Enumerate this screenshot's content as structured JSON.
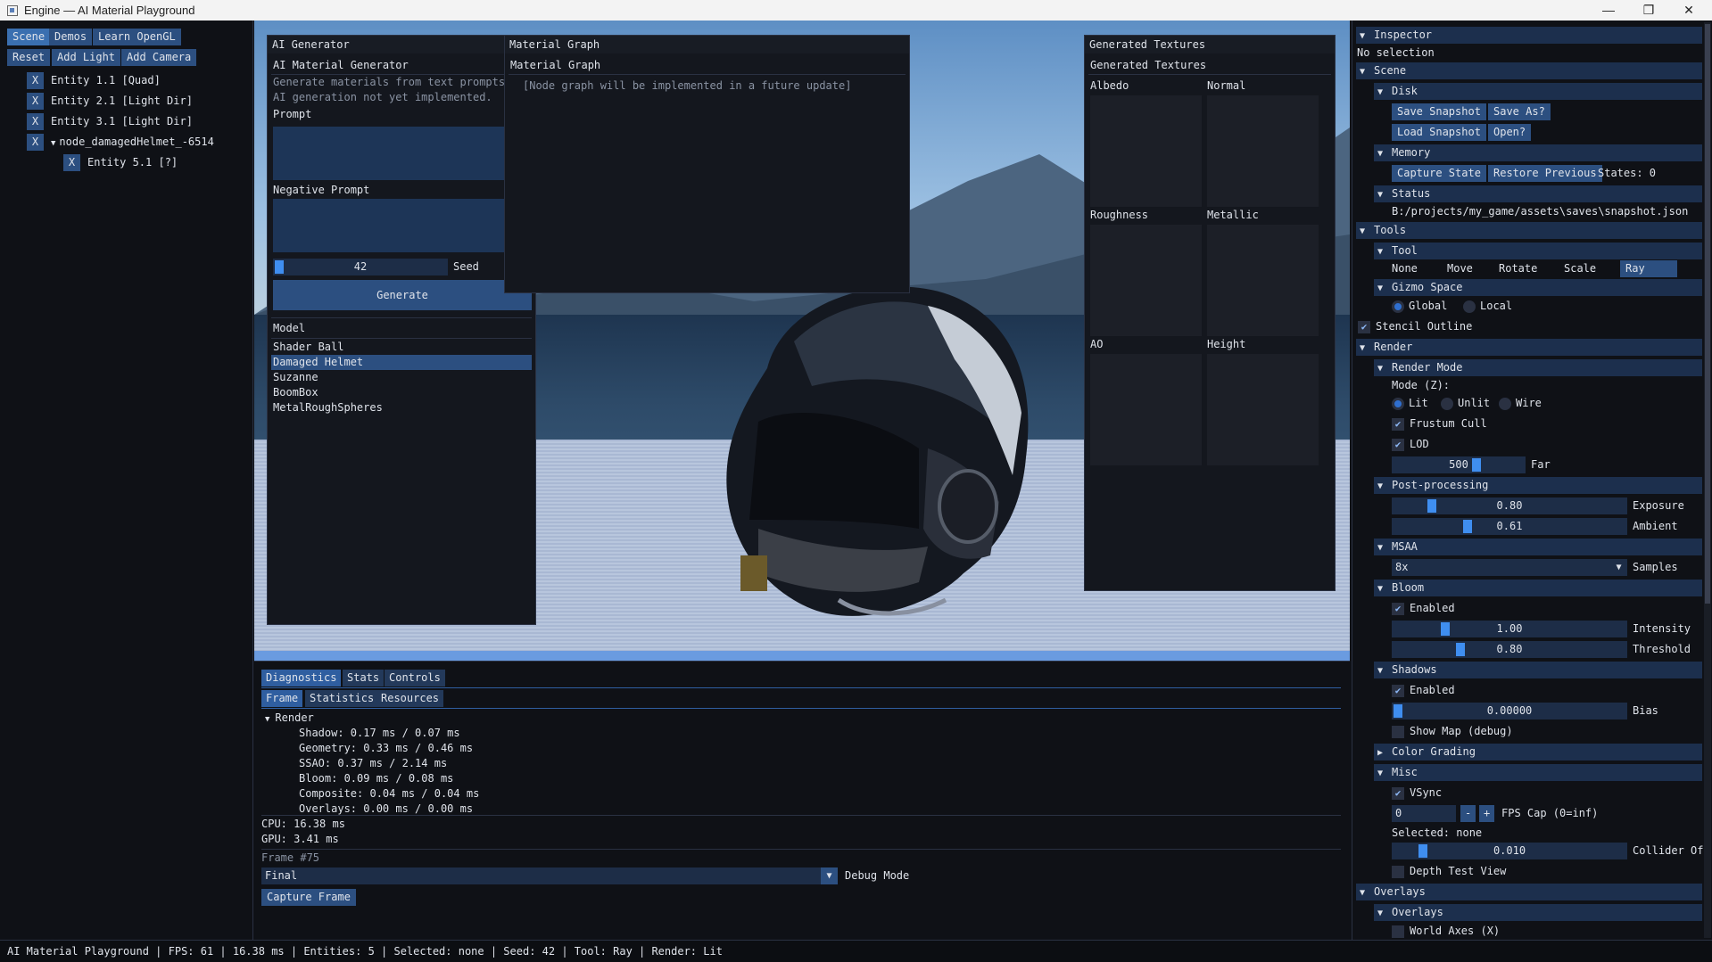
{
  "window": {
    "title": "Engine — AI Material Playground",
    "minimize": "—",
    "maximize": "❐",
    "close": "✕"
  },
  "toolbar": {
    "tabs": [
      "Scene",
      "Demos",
      "Learn OpenGL"
    ],
    "reset": "Reset",
    "add_light": "Add Light",
    "add_camera": "Add Camera"
  },
  "hierarchy": [
    {
      "x": "X",
      "label": "Entity 1.1  [Quad]"
    },
    {
      "x": "X",
      "label": "Entity 2.1  [Light Dir]"
    },
    {
      "x": "X",
      "label": "Entity 3.1  [Light Dir]"
    },
    {
      "x": "X",
      "label": "node_damagedHelmet_-6514",
      "expanded": true
    },
    {
      "x": "X",
      "label": "Entity 5.1  [?]"
    }
  ],
  "ai": {
    "window_title": "AI Generator",
    "header": "AI Material Generator",
    "desc1": "Generate materials from text prompts.",
    "desc2": "AI generation not yet implemented.",
    "prompt_label": "Prompt",
    "negative_label": "Negative Prompt",
    "seed_value": "42",
    "seed_label": "Seed",
    "generate": "Generate",
    "model_label": "Model",
    "models": [
      "Shader Ball",
      "Damaged Helmet",
      "Suzanne",
      "BoomBox",
      "MetalRoughSpheres"
    ],
    "selected_model": "Damaged Helmet"
  },
  "graph": {
    "window_title": "Material Graph",
    "header": "Material Graph",
    "note": "[Node graph will be implemented in a future update]"
  },
  "textures": {
    "window_title": "Generated Textures",
    "header": "Generated Textures",
    "slots": [
      "Albedo",
      "Normal",
      "Roughness",
      "Metallic",
      "AO",
      "Height"
    ]
  },
  "diag": {
    "tabs": [
      "Diagnostics",
      "Stats",
      "Controls"
    ],
    "subtabs": [
      "Frame",
      "Statistics",
      "Resources"
    ],
    "render_label": "Render",
    "lines": [
      "Shadow: 0.17 ms / 0.07 ms",
      "Geometry: 0.33 ms / 0.46 ms",
      "SSAO: 0.37 ms / 2.14 ms",
      "Bloom: 0.09 ms / 0.08 ms",
      "Composite: 0.04 ms / 0.04 ms",
      "Overlays: 0.00 ms / 0.00 ms"
    ],
    "cpu": "CPU: 16.38 ms",
    "gpu": "GPU: 3.41 ms",
    "frame": "Frame #75",
    "debug_value": "Final",
    "debug_label": "Debug Mode",
    "capture": "Capture Frame"
  },
  "inspector": {
    "title": "Inspector",
    "no_selection": "No selection",
    "scene": "Scene",
    "disk": "Disk",
    "save_snapshot": "Save Snapshot",
    "save_as": "Save As?",
    "load_snapshot": "Load Snapshot",
    "open": "Open?",
    "memory": "Memory",
    "capture_state": "Capture State",
    "restore_previous": "Restore Previous",
    "states": "States: 0",
    "status": "Status",
    "status_path": "B:/projects/my_game/assets\\saves\\snapshot.json",
    "tools": "Tools",
    "tool": "Tool",
    "tool_options": [
      "None",
      "Move",
      "Rotate",
      "Scale",
      "Ray"
    ],
    "tool_selected": "Ray",
    "gizmo_space": "Gizmo Space",
    "global": "Global",
    "local": "Local",
    "stencil": "Stencil Outline",
    "render": "Render",
    "render_mode": "Render Mode",
    "mode_label": "Mode (Z):",
    "modes": [
      "Lit",
      "Unlit",
      "Wire"
    ],
    "frustum": "Frustum Cull",
    "lod": "LOD",
    "far_value": "500",
    "far_label": "Far",
    "post": "Post-processing",
    "exposure_value": "0.80",
    "exposure_label": "Exposure",
    "ambient_value": "0.61",
    "ambient_label": "Ambient",
    "msaa": "MSAA",
    "samples_value": "8x",
    "samples_label": "Samples",
    "bloom": "Bloom",
    "bloom_enabled": "Enabled",
    "intensity_value": "1.00",
    "intensity_label": "Intensity",
    "threshold_value": "0.80",
    "threshold_label": "Threshold",
    "shadows": "Shadows",
    "shadows_enabled": "Enabled",
    "bias_value": "0.00000",
    "bias_label": "Bias",
    "show_map": "Show Map (debug)",
    "color_grading": "Color Grading",
    "misc": "Misc",
    "vsync": "VSync",
    "fps_value": "0",
    "minus": "-",
    "plus": "+",
    "fps_label": "FPS Cap (0=inf)",
    "selected": "Selected: none",
    "collider_value": "0.010",
    "collider_label": "Collider Of",
    "depth_test": "Depth Test View",
    "overlays": "Overlays",
    "overlays_sub": "Overlays",
    "world_axes": "World Axes (X)"
  },
  "statusbar": "AI Material Playground   |   FPS: 61   |   16.38 ms   |   Entities: 5   |   Selected: none   |   Seed: 42   |   Tool: Ray   |   Render: Lit",
  "colors": {
    "accent": "#2f6fd0",
    "panel": "#14171e",
    "header": "#1c2f4d"
  }
}
